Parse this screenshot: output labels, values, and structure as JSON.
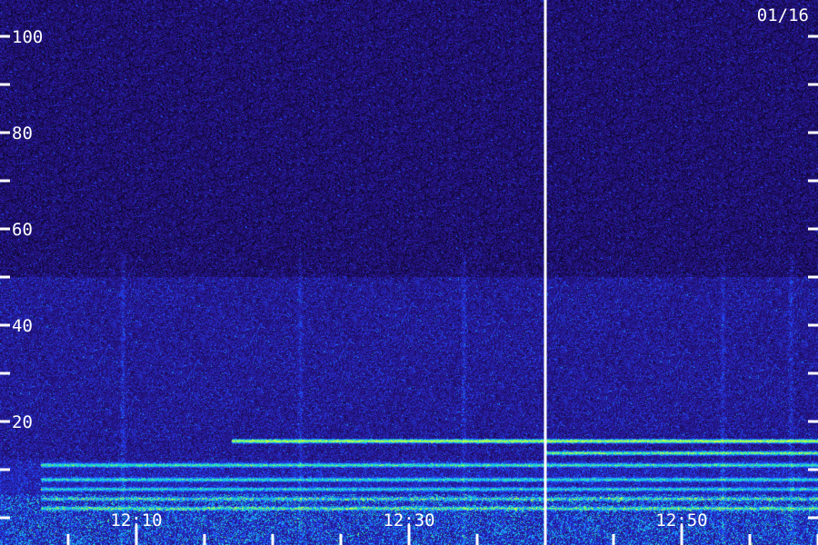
{
  "chart_data": {
    "type": "heatmap",
    "title": "",
    "date_label": "01/16",
    "xlabel": "",
    "ylabel": "",
    "y_axis": {
      "range": [
        0,
        102
      ],
      "major_ticks": [
        20,
        40,
        60,
        80,
        100
      ],
      "minor_ticks": [
        0,
        10,
        30,
        50,
        70,
        90
      ],
      "tick_labels": [
        "20",
        "40",
        "60",
        "80",
        "100"
      ]
    },
    "x_axis": {
      "range": [
        "12:03",
        "12:63"
      ],
      "tick_labels": [
        "12:10",
        "12:30",
        "12:50"
      ],
      "tick_minutes": [
        10,
        30,
        50
      ],
      "minor_tick_minutes": [
        5,
        15,
        20,
        25,
        35,
        40,
        45,
        55,
        60
      ],
      "range_minutes": [
        3,
        63
      ]
    },
    "marker_minute": 40,
    "color_scale": [
      "#000000",
      "#1a0a55",
      "#2a1aa0",
      "#1e48ff",
      "#1ab0ff",
      "#20e8b0",
      "#c8ff40"
    ],
    "features": {
      "noise_floor_below": 50,
      "tonal_lines": [
        {
          "freq": 16,
          "start_minute": 17,
          "end_minute": 63,
          "intensity": 0.95
        },
        {
          "freq": 13.5,
          "start_minute": 40,
          "end_minute": 63,
          "intensity": 0.8
        },
        {
          "freq": 11,
          "start_minute": 3,
          "end_minute": 63,
          "intensity": 0.6
        },
        {
          "freq": 8,
          "start_minute": 3,
          "end_minute": 63,
          "intensity": 0.55
        },
        {
          "freq": 6,
          "start_minute": 3,
          "end_minute": 63,
          "intensity": 0.5
        },
        {
          "freq": 4,
          "start_minute": 3,
          "end_minute": 63,
          "intensity": 0.45
        },
        {
          "freq": 2,
          "start_minute": 3,
          "end_minute": 63,
          "intensity": 0.55
        }
      ],
      "broadband_streaks_minutes": [
        9,
        22,
        34,
        53,
        58
      ]
    }
  }
}
